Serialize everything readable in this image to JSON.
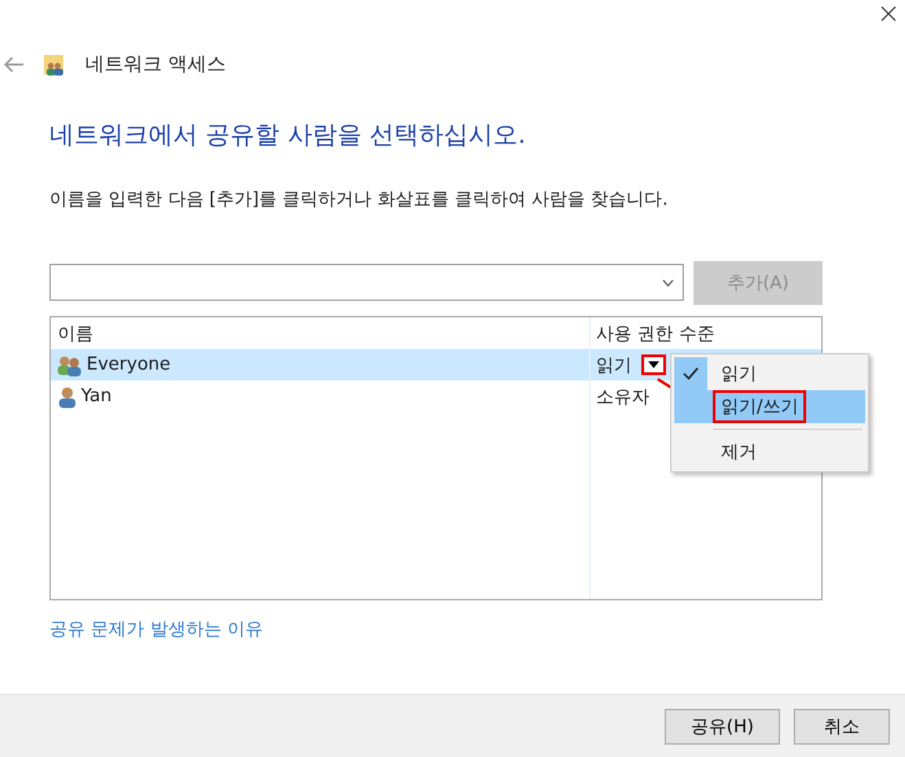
{
  "window": {
    "title": "네트워크 액세스"
  },
  "heading": "네트워크에서 공유할 사람을 선택하십시오.",
  "instruction": "이름을 입력한 다음 [추가]를 클릭하거나 화살표를 클릭하여 사람을 찾습니다.",
  "add_button": {
    "label": "추가(A)",
    "disabled": true
  },
  "table": {
    "columns": [
      "이름",
      "사용 권한 수준"
    ],
    "rows": [
      {
        "name": "Everyone",
        "permission": "읽기",
        "kind": "group",
        "selected": true
      },
      {
        "name": "Yan",
        "permission": "소유자",
        "kind": "user",
        "selected": false
      }
    ]
  },
  "permission_menu": {
    "items": [
      {
        "label": "읽기",
        "kind": "item",
        "checked": true,
        "selected": false
      },
      {
        "label": "읽기/쓰기",
        "kind": "item",
        "checked": false,
        "selected": true
      },
      {
        "label": "제거",
        "kind": "separated",
        "checked": false,
        "selected": false
      }
    ]
  },
  "help_link": "공유 문제가 발생하는 이유",
  "buttons": [
    "공유(H)",
    "취소"
  ]
}
